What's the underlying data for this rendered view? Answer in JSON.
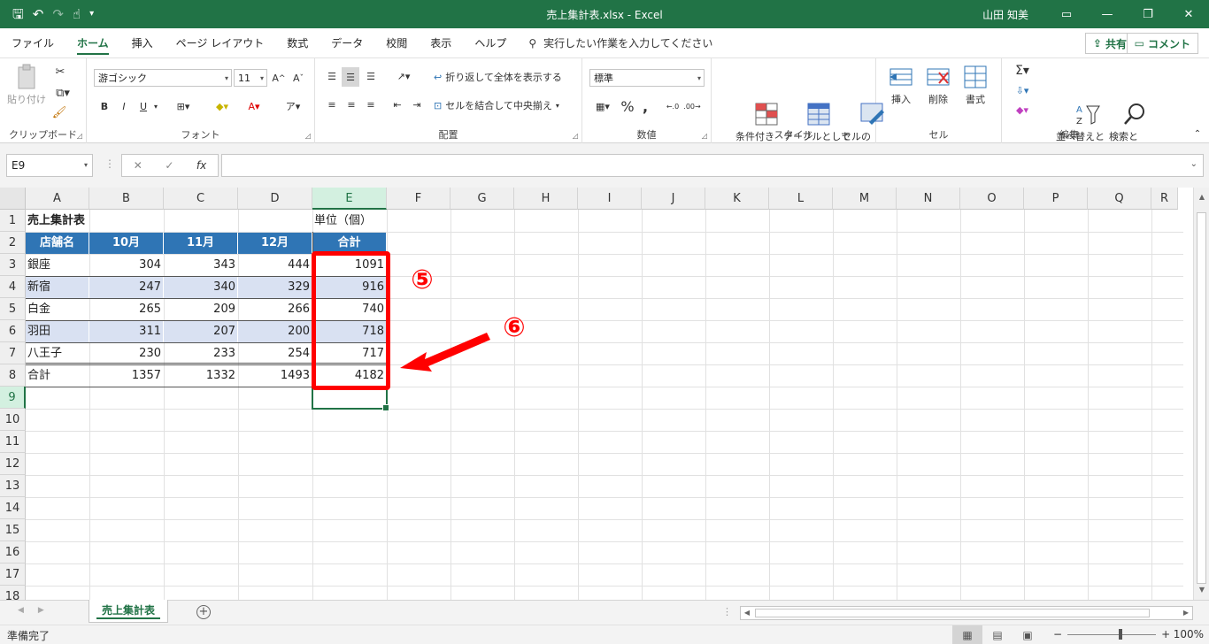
{
  "window": {
    "title": "売上集計表.xlsx  -  Excel",
    "user": "山田 知美"
  },
  "tabs": [
    "ファイル",
    "ホーム",
    "挿入",
    "ページ レイアウト",
    "数式",
    "データ",
    "校閲",
    "表示",
    "ヘルプ"
  ],
  "active_tab": "ホーム",
  "tell_me": "実行したい作業を入力してください",
  "share_label": "共有",
  "comment_label": "コメント",
  "ribbon": {
    "clipboard": {
      "label": "クリップボード",
      "paste": "貼り付け"
    },
    "font": {
      "label": "フォント",
      "name": "游ゴシック",
      "size": "11",
      "bold": "B",
      "italic": "I",
      "underline": "U"
    },
    "alignment": {
      "label": "配置",
      "wrap": "折り返して全体を表示する",
      "merge": "セルを結合して中央揃え"
    },
    "number": {
      "label": "数値",
      "format": "標準"
    },
    "styles": {
      "label": "スタイル",
      "conditional": "条件付き\n書式",
      "table": "テーブルとして\n書式設定",
      "cell_styles": "セルの\nスタイル"
    },
    "cells": {
      "label": "セル",
      "insert": "挿入",
      "delete": "削除",
      "format": "書式"
    },
    "editing": {
      "label": "編集",
      "sort": "並べ替えと\nフィルター",
      "find": "検索と\n選択"
    }
  },
  "formula_bar": {
    "name_box": "E9",
    "formula": ""
  },
  "columns": [
    "A",
    "B",
    "C",
    "D",
    "E",
    "F",
    "G",
    "H",
    "I",
    "J",
    "K",
    "L",
    "M",
    "N",
    "O",
    "P",
    "Q",
    "R"
  ],
  "rows": [
    "1",
    "2",
    "3",
    "4",
    "5",
    "6",
    "7",
    "8",
    "9",
    "10",
    "11",
    "12",
    "13",
    "14",
    "15",
    "16",
    "17",
    "18"
  ],
  "sheet": {
    "title": "売上集計表",
    "unit": "単位（個）",
    "headers": [
      "店舗名",
      "10月",
      "11月",
      "12月",
      "合計"
    ],
    "data": [
      [
        "銀座",
        "304",
        "343",
        "444",
        "1091"
      ],
      [
        "新宿",
        "247",
        "340",
        "329",
        "916"
      ],
      [
        "白金",
        "265",
        "209",
        "266",
        "740"
      ],
      [
        "羽田",
        "311",
        "207",
        "200",
        "718"
      ],
      [
        "八王子",
        "230",
        "233",
        "254",
        "717"
      ],
      [
        "合計",
        "1357",
        "1332",
        "1493",
        "4182"
      ]
    ]
  },
  "annotations": {
    "step5": "⑤",
    "step6": "⑥"
  },
  "sheet_tab": "売上集計表",
  "status": {
    "text": "準備完了",
    "zoom": "100%"
  },
  "colors": {
    "excel_green": "#217346",
    "header_blue": "#2f75b5",
    "band": "#d9e1f2",
    "annotation_red": "#ff0000"
  }
}
